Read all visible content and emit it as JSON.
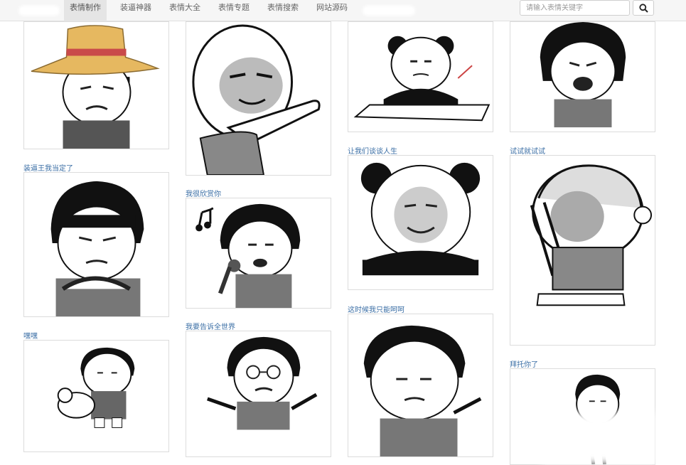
{
  "nav": {
    "items": [
      "表情制作",
      "装逼神器",
      "表情大全",
      "表情专题",
      "表情搜索",
      "网站源码"
    ],
    "active_index": 0
  },
  "search": {
    "placeholder": "请输入表情关键字",
    "icon": "search-icon"
  },
  "cards": [
    {
      "caption": "",
      "meme": "straw-hat-bowl-cut"
    },
    {
      "caption": "装逼王我当定了",
      "meme": "bowl-cut-scheming"
    },
    {
      "caption": "嘿嘿",
      "meme": "bowl-cut-with-puppy"
    },
    {
      "caption": "",
      "meme": "smug-round-face-pointing"
    },
    {
      "caption": "我很欣赏你",
      "meme": "bowl-cut-singing"
    },
    {
      "caption": "我要告诉全世界",
      "meme": "bowl-cut-glasses-shrug"
    },
    {
      "caption": "",
      "meme": "panda-smoking-at-desk"
    },
    {
      "caption": "让我们谈谈人生",
      "meme": "panda-smiling"
    },
    {
      "caption": "这时候我只能呵呵",
      "meme": "bowl-cut-hehe-shrug"
    },
    {
      "caption": "",
      "meme": "bowl-cut-crying"
    },
    {
      "caption": "试试就试试",
      "meme": "bald-kid-praying"
    },
    {
      "caption": "拜托你了",
      "meme": "bowl-cut-begging"
    }
  ],
  "colors": {
    "caption": "#3a6ea5",
    "nav_bg": "#f6f6f6",
    "nav_active_bg": "#e5e5e5",
    "card_border": "#dcdcdc"
  }
}
